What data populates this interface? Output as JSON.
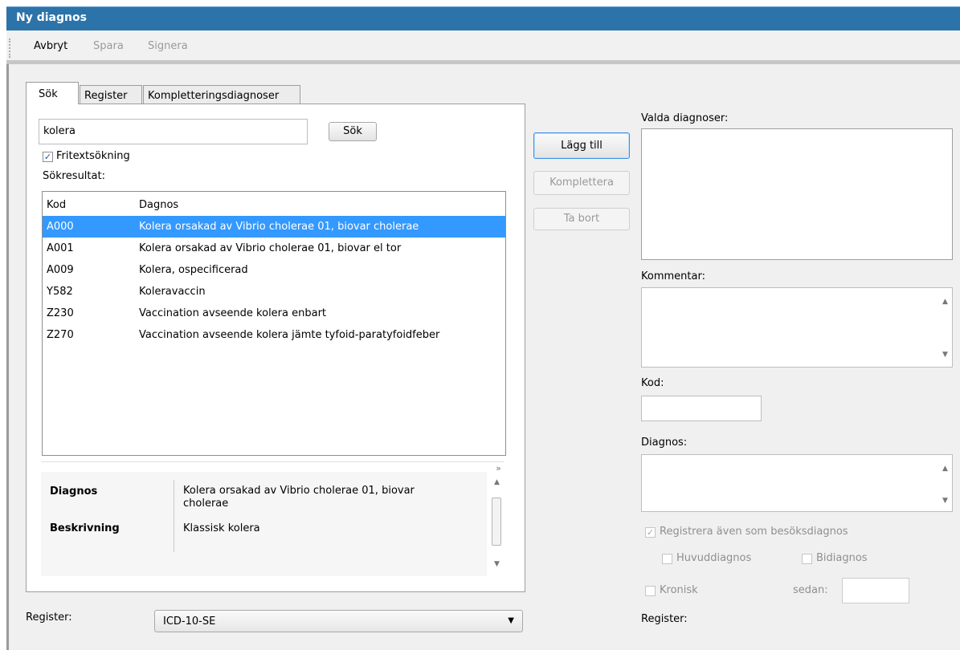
{
  "window": {
    "title": "Ny diagnos"
  },
  "toolbar": {
    "cancel": "Avbryt",
    "save": "Spara",
    "sign": "Signera"
  },
  "tabs": [
    {
      "label": "Sök",
      "active": true
    },
    {
      "label": "Register",
      "active": false
    },
    {
      "label": "Kompletteringsdiagnoser",
      "active": false
    }
  ],
  "search": {
    "query": "kolera",
    "button": "Sök",
    "freetext_label": "Fritextsökning",
    "freetext_checked": true,
    "results_label": "Sökresultat:"
  },
  "results": {
    "headers": [
      "Kod",
      "Dagnos"
    ],
    "rows": [
      {
        "code": "A000",
        "diagnosis": "Kolera orsakad av Vibrio cholerae 01, biovar cholerae",
        "selected": true
      },
      {
        "code": "A001",
        "diagnosis": "Kolera orsakad av Vibrio cholerae 01, biovar el tor",
        "selected": false
      },
      {
        "code": "A009",
        "diagnosis": "Kolera, ospecificerad",
        "selected": false
      },
      {
        "code": "Y582",
        "diagnosis": "Koleravaccin",
        "selected": false
      },
      {
        "code": "Z230",
        "diagnosis": "Vaccination avseende kolera enbart",
        "selected": false
      },
      {
        "code": "Z270",
        "diagnosis": "Vaccination avseende kolera jämte tyfoid-paratyfoidfeber",
        "selected": false
      }
    ]
  },
  "details": {
    "diag_label": "Diagnos",
    "diag_value_line1": "Kolera orsakad av Vibrio cholerae 01, biovar",
    "diag_value_line2": "cholerae",
    "desc_label": "Beskrivning",
    "desc_value": "Klassisk kolera"
  },
  "register_left": {
    "label": "Register:",
    "value": "ICD-10-SE"
  },
  "actions": {
    "add": "Lägg till",
    "complete": "Komplettera",
    "remove": "Ta bort"
  },
  "right": {
    "chosen_label": "Valda diagnoser:",
    "comment_label": "Kommentar:",
    "code_label": "Kod:",
    "code_value": "",
    "diagnosis_label": "Diagnos:",
    "visit_diag_label": "Registrera även som besöksdiagnos",
    "main_diag_label": "Huvuddiagnos",
    "bi_diag_label": "Bidiagnos",
    "chronic_label": "Kronisk",
    "since_label": "sedan:",
    "register_label": "Register:"
  },
  "colors": {
    "titlebar": "#2c73a9",
    "selection": "#3399ff",
    "background": "#f0f0f0"
  }
}
